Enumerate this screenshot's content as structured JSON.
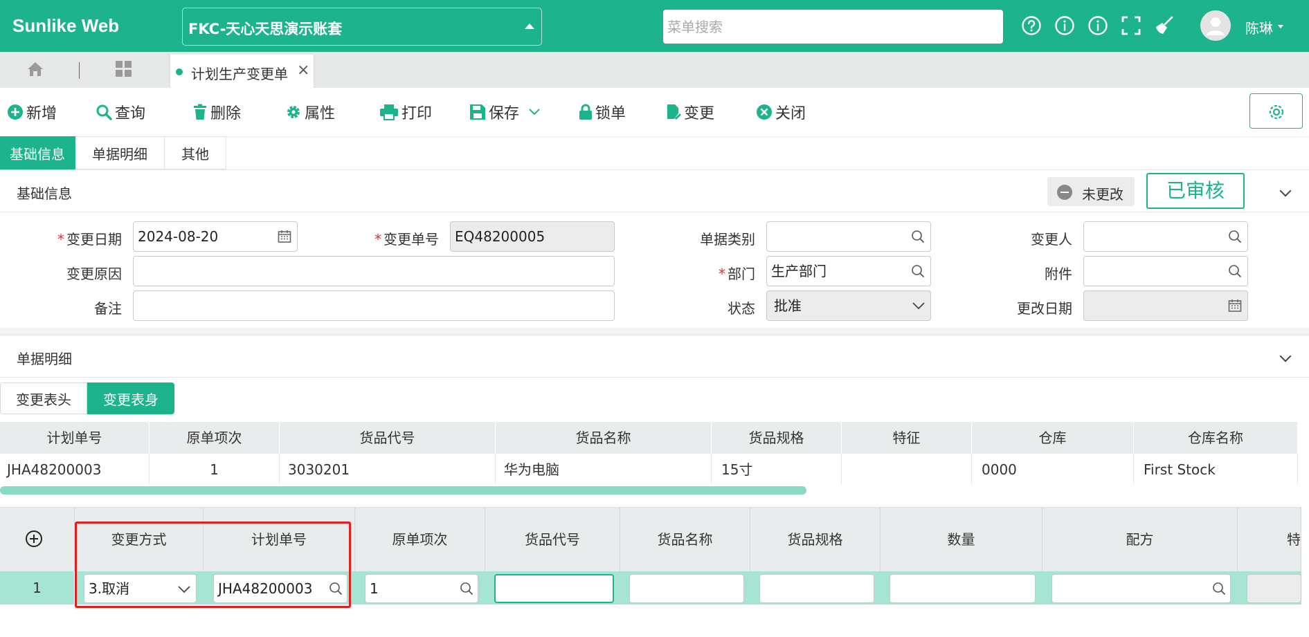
{
  "app": {
    "brand": "Sunlike Web",
    "account_name": "FKC-天心天思演示账套",
    "menu_search_placeholder": "菜单搜索",
    "user_name": "陈琳",
    "colors": {
      "accent": "#1db38c",
      "required": "#e03030",
      "highlight": "#e02020"
    }
  },
  "header_icons": [
    "help-icon",
    "info-icon",
    "about-icon",
    "fullscreen-icon",
    "clear-cache-icon"
  ],
  "tabs": {
    "home_icon": "home-icon",
    "apps_icon": "grid-icon",
    "open_tab": {
      "label": "计划生产变更单",
      "close": "×"
    }
  },
  "toolbar": {
    "add": "新增",
    "query": "查询",
    "delete": "删除",
    "properties": "属性",
    "print": "打印",
    "save": "保存",
    "lock": "锁单",
    "change": "变更",
    "close": "关闭"
  },
  "section_tabs": [
    "基础信息",
    "单据明细",
    "其他"
  ],
  "basic": {
    "title": "基础信息",
    "badge_unchanged": "未更改",
    "stamp": "已审核",
    "fields": {
      "change_date_label": "变更日期",
      "change_date_value": "2024-08-20",
      "change_no_label": "变更单号",
      "change_no_value": "EQ48200005",
      "doc_type_label": "单据类别",
      "doc_type_value": "",
      "changer_label": "变更人",
      "changer_value": "",
      "reason_label": "变更原因",
      "reason_value": "",
      "dept_label": "部门",
      "dept_value": "生产部门",
      "attachment_label": "附件",
      "attachment_value": "",
      "remark_label": "备注",
      "remark_value": "",
      "status_label": "状态",
      "status_value": "批准",
      "modify_date_label": "更改日期",
      "modify_date_value": ""
    }
  },
  "detail": {
    "title": "单据明细",
    "subtabs": [
      "变更表头",
      "变更表身"
    ],
    "table1": {
      "headers": [
        "计划单号",
        "原单项次",
        "货品代号",
        "货品名称",
        "货品规格",
        "特征",
        "仓库",
        "仓库名称"
      ],
      "rows": [
        [
          "JHA48200003",
          "1",
          "3030201",
          "华为电脑",
          "15寸",
          "",
          "0000",
          "First Stock"
        ]
      ]
    },
    "table2": {
      "add_icon": "add-row-icon",
      "headers": [
        "变更方式",
        "计划单号",
        "原单项次",
        "货品代号",
        "货品名称",
        "货品规格",
        "数量",
        "配方",
        "特"
      ],
      "row": {
        "index": "1",
        "change_mode": "3.取消",
        "plan_no": "JHA48200003",
        "orig_item": "1",
        "item_code": "",
        "item_name": "",
        "item_spec": "",
        "qty": "",
        "formula": ""
      }
    }
  }
}
